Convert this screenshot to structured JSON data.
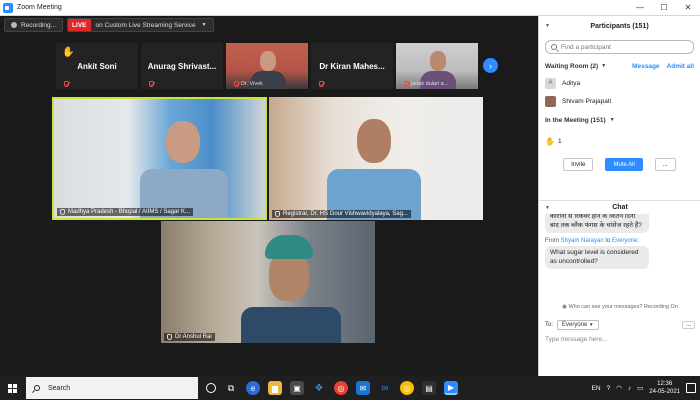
{
  "window": {
    "title": "Zoom Meeting"
  },
  "controls": {
    "recording": "Recording...",
    "live_badge": "LIVE",
    "live_label": "on Custom Live Streaming Service"
  },
  "strip": [
    {
      "name": "Ankit Soni",
      "label": ""
    },
    {
      "name": "Anurag  Shrivast...",
      "label": ""
    },
    {
      "name": "",
      "label": "Dr. Vivek"
    },
    {
      "name": "Dr Kiran Mahes...",
      "label": ""
    },
    {
      "name": "",
      "label": "janak dulari a..."
    }
  ],
  "videos": [
    {
      "label": "Madhya Pradesh - Bhopal / AIIMS / Sagar K..."
    },
    {
      "label": "Registrar, Dr. HS Gour Vishwavidyalaya, Sag..."
    },
    {
      "label": "Dr Anshul Rai"
    }
  ],
  "participants": {
    "header": "Participants (151)",
    "search_placeholder": "Find a participant",
    "waiting_room": "Waiting Room  (2)",
    "message": "Message",
    "admit_all": "Admit all",
    "waiting": [
      {
        "initial": "A",
        "name": "Aditya"
      },
      {
        "initial": "",
        "name": "Shivam Prajapati"
      }
    ],
    "in_meeting": "In the Meeting (151)",
    "hand_count": "1",
    "invite": "Invite",
    "mute_all": "Mute All",
    "more": "..."
  },
  "chat": {
    "header": "Chat",
    "msg1": "कोरोना से रिकवर होने के कितने दिनों बाद तक ब्लैक फंगस के चांसेज रहते हैं?",
    "from_name": "Shyam Narayan",
    "from_mid": " to ",
    "from_to": "Everyone",
    "from_suffix": ":",
    "msg2": "What sugar level is considered as uncontrolled?",
    "privacy": "Who can see your messages? Recording On",
    "to_label": "To:",
    "to_value": "Everyone",
    "to_more": "...",
    "input_placeholder": "Type message here..."
  },
  "taskbar": {
    "search": "Search",
    "lang": "EN",
    "time": "12:36",
    "date": "24-05-2021"
  }
}
